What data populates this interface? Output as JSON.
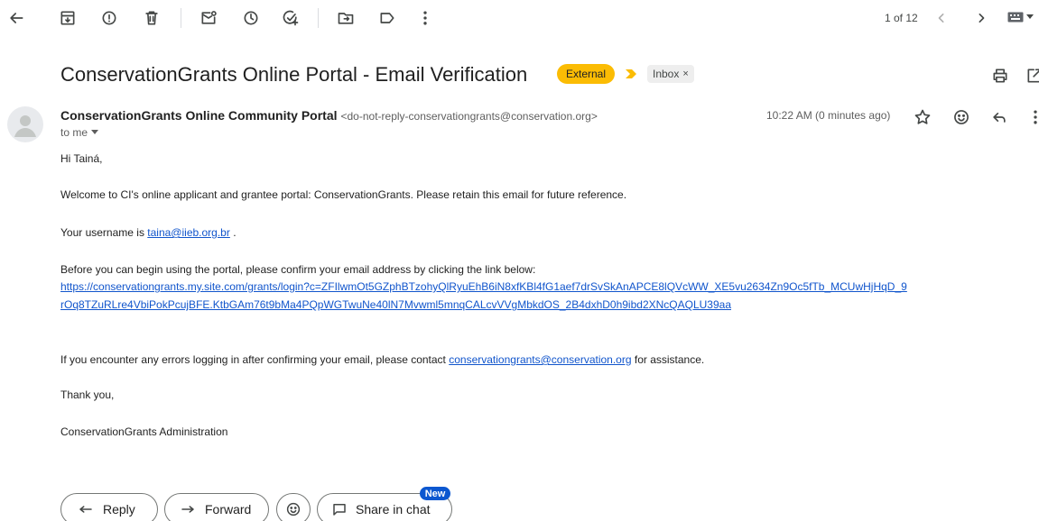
{
  "toolbar": {
    "pagination": "1 of 12"
  },
  "subject": {
    "title": "ConservationGrants Online Portal - Email Verification",
    "external_badge": "External",
    "label_chip": "Inbox",
    "label_chip_close": "×"
  },
  "message": {
    "sender_name": "ConservationGrants Online Community Portal",
    "sender_email": "<do-not-reply-conservationgrants@conservation.org>",
    "recipient": "to me",
    "timestamp": "10:22 AM (0 minutes ago)",
    "greeting": "Hi Tainá,",
    "welcome": "Welcome to CI's online applicant and grantee portal: ConservationGrants. Please retain this email for future reference.",
    "username_prefix": "Your username is ",
    "username": "taina@iieb.org.br",
    "username_suffix": " .",
    "confirm_text": "Before you can begin using the portal, please confirm your email address by clicking the link below:",
    "confirm_link_line1": "https://conservationgrants.my.site.com/grants/login?c=ZFIlwmOt5GZphBTzohyQlRyuEhB6iN8xfKBl4fG1aef7drSvSkAnAPCE8lQVcWW_XE5vu2634Zn9Oc5fTb_MCUwHjHqD_9",
    "confirm_link_line2": "rOq8TZuRLre4VbiPokPcujBFE.KtbGAm76t9bMa4PQpWGTwuNe40lN7Mvwml5mnqCALcvVVgMbkdOS_2B4dxhD0h9ibd2XNcQAQLU39aa",
    "errors_prefix": "If you encounter any errors logging in after confirming your email, please contact ",
    "support_email": "conservationgrants@conservation.org",
    "errors_suffix": " for assistance.",
    "thanks": "Thank you,",
    "signature": "ConservationGrants Administration"
  },
  "actions": {
    "reply": "Reply",
    "forward": "Forward",
    "share": "Share in chat",
    "new_badge": "New"
  },
  "colors": {
    "external_badge": "#fbbc04",
    "link": "#1155cc",
    "new_badge": "#0b57d0"
  }
}
